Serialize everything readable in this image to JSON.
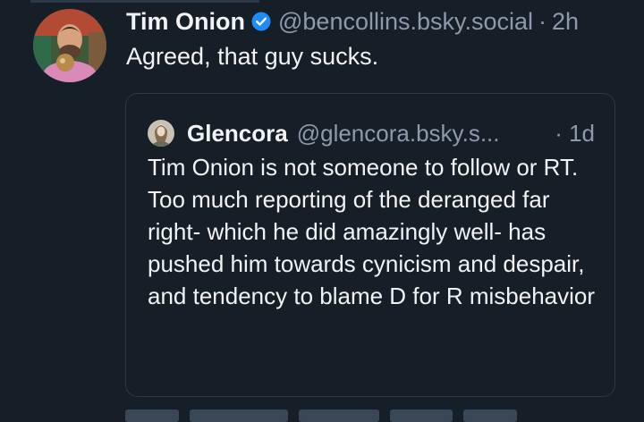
{
  "post": {
    "author_name": "Tim Onion",
    "handle": "@bencollins.bsky.social",
    "separator": "·",
    "time": "2h",
    "text": "Agreed, that guy sucks.",
    "verified_icon": "verified-check-icon",
    "avatar_icon": "user-photo-avatar"
  },
  "quote": {
    "author_name": "Glencora",
    "handle": "@glencora.bsky.s...",
    "time": "· 1d",
    "text": "Tim Onion is not someone to follow or RT. Too much reporting of the deranged far right- which he did amazingly well- has pushed him towards cynicism and despair, and tendency to blame D for R misbehavior",
    "avatar_icon": "user-photo-avatar"
  },
  "colors": {
    "background": "#161e27",
    "text": "#f1f3f5",
    "muted": "#8d9aab",
    "verified": "#1d8cf8",
    "card_border": "#2e3a48"
  }
}
